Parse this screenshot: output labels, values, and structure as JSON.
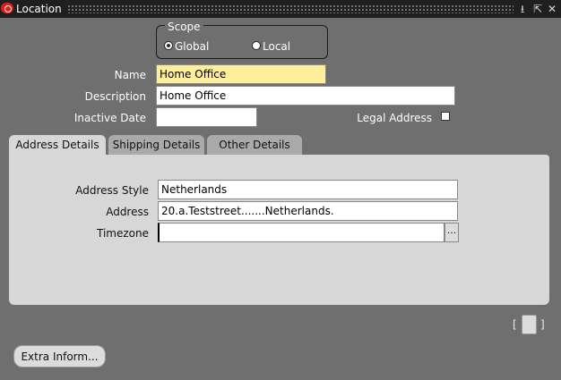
{
  "window": {
    "title": "Location"
  },
  "scope": {
    "title": "Scope",
    "options": [
      {
        "label": "Global",
        "selected": true
      },
      {
        "label": "Local",
        "selected": false
      }
    ]
  },
  "form": {
    "name_label": "Name",
    "name_value": "Home Office",
    "description_label": "Description",
    "description_value": "Home Office",
    "inactive_date_label": "Inactive Date",
    "inactive_date_value": "",
    "legal_address_label": "Legal Address"
  },
  "tabs": [
    {
      "label": "Address Details",
      "active": true
    },
    {
      "label": "Shipping Details",
      "active": false
    },
    {
      "label": "Other Details",
      "active": false
    }
  ],
  "address_details": {
    "address_style_label": "Address Style",
    "address_style_value": "Netherlands",
    "address_label": "Address",
    "address_value": "20.a.Teststreet.......Netherlands.",
    "timezone_label": "Timezone",
    "timezone_value": "",
    "lov_glyph": "..."
  },
  "buttons": {
    "extra_info": "Extra Inform..."
  },
  "colors": {
    "logo": "#e41b17",
    "required_field": "#ffef9b",
    "background": "#6f6f6f",
    "panel": "#d7d7d7"
  }
}
